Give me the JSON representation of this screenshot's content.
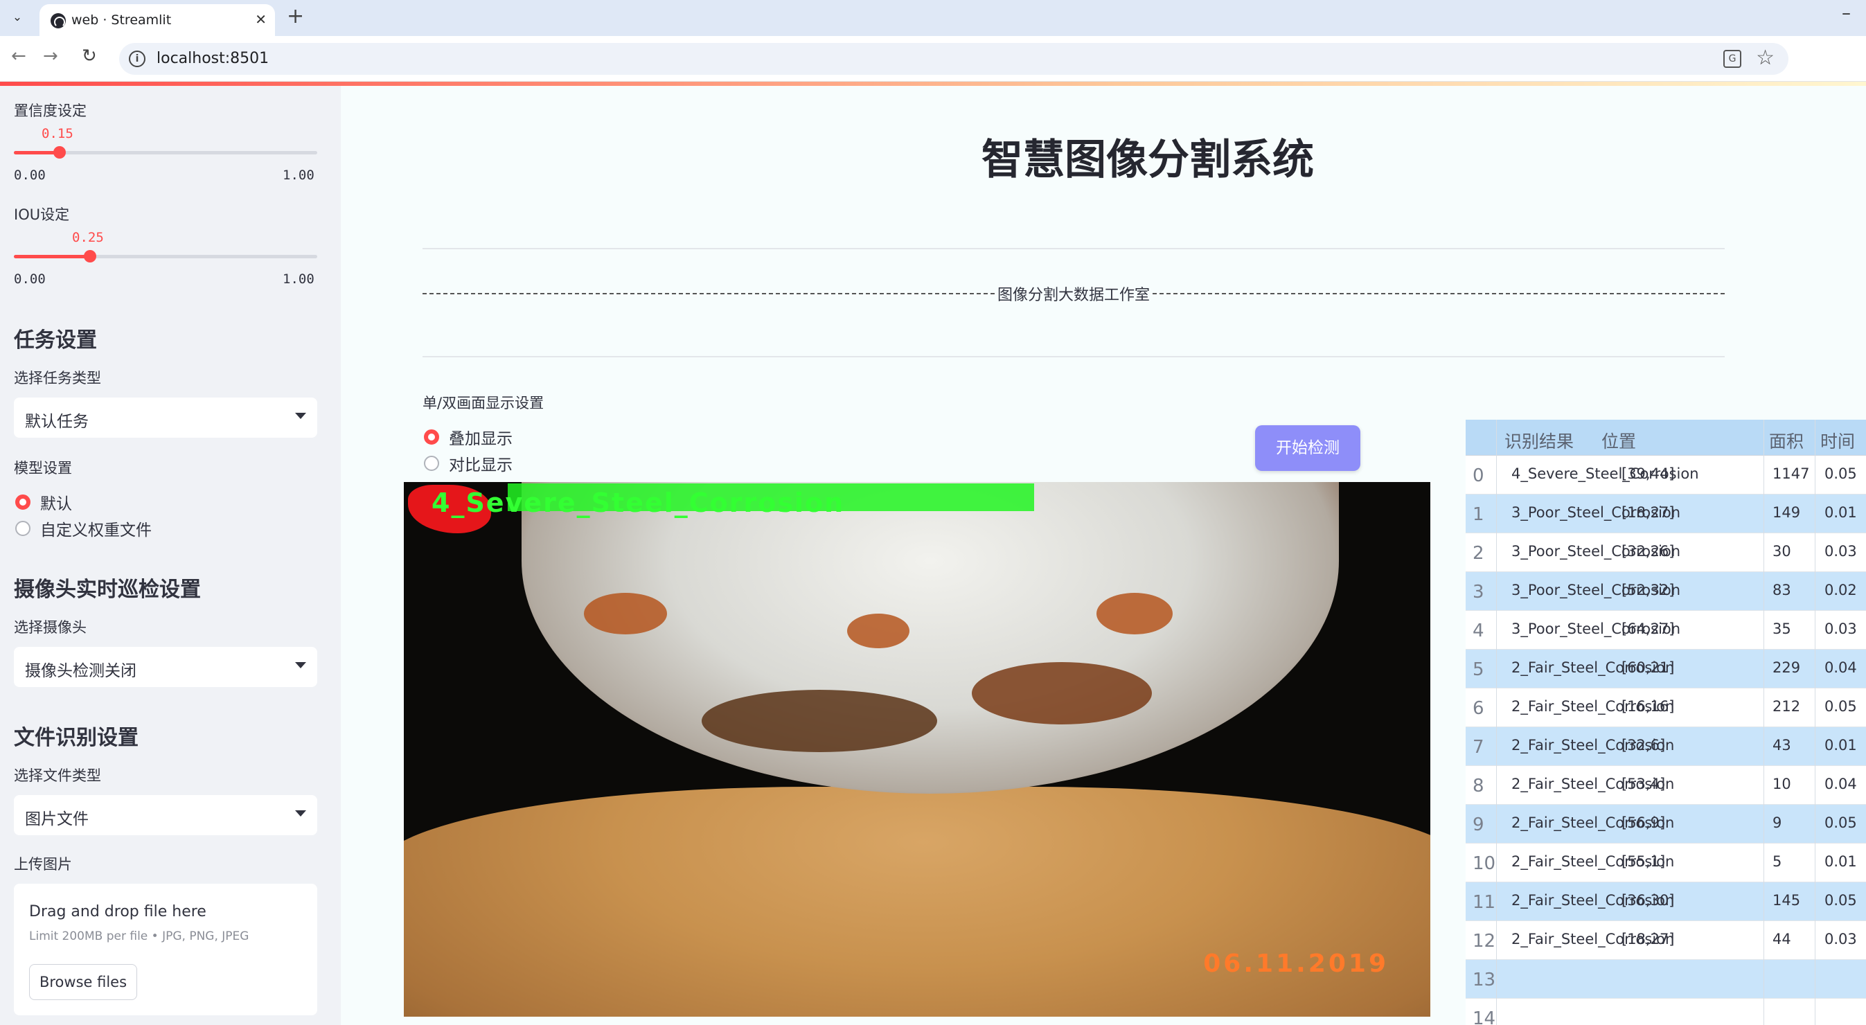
{
  "browser": {
    "tab_title": "web · Streamlit",
    "url": "localhost:8501"
  },
  "sidebar": {
    "confidence": {
      "label": "置信度设定",
      "value": "0.15",
      "fraction": 0.15,
      "min": "0.00",
      "max": "1.00"
    },
    "iou": {
      "label": "IOU设定",
      "value": "0.25",
      "fraction": 0.25,
      "min": "0.00",
      "max": "1.00"
    },
    "task_header": "任务设置",
    "task_type_label": "选择任务类型",
    "task_type_value": "默认任务",
    "model_label": "模型设置",
    "model_options": [
      "默认",
      "自定义权重文件"
    ],
    "model_selected": "默认",
    "camera_header": "摄像头实时巡检设置",
    "camera_label": "选择摄像头",
    "camera_value": "摄像头检测关闭",
    "file_header": "文件识别设置",
    "file_type_label": "选择文件类型",
    "file_type_value": "图片文件",
    "upload_label": "上传图片",
    "upload_title": "Drag and drop file here",
    "upload_hint": "Limit 200MB per file • JPG, PNG, JPEG",
    "browse_label": "Browse files"
  },
  "main": {
    "title": "智慧图像分割系统",
    "studio_text": "图像分割大数据工作室",
    "display_mode_label": "单/双画面显示设置",
    "display_options": [
      "叠加显示",
      "对比显示"
    ],
    "display_selected": "叠加显示",
    "start_button": "开始检测",
    "image": {
      "overlay_label": "4_Severe_Steel_Corrosion",
      "date_stamp": "06.11.2019"
    }
  },
  "table": {
    "columns": [
      "识别结果",
      "位置",
      "面积",
      "时间"
    ],
    "rows": [
      {
        "idx": "0",
        "result": "4_Severe_Steel_Corrosion",
        "pos": "[39,44]",
        "area": "1147",
        "time": "0.05"
      },
      {
        "idx": "1",
        "result": "3_Poor_Steel_Corrosion",
        "pos": "[18,27]",
        "area": "149",
        "time": "0.01"
      },
      {
        "idx": "2",
        "result": "3_Poor_Steel_Corrosion",
        "pos": "[32,26]",
        "area": "30",
        "time": "0.03"
      },
      {
        "idx": "3",
        "result": "3_Poor_Steel_Corrosion",
        "pos": "[52,32]",
        "area": "83",
        "time": "0.02"
      },
      {
        "idx": "4",
        "result": "3_Poor_Steel_Corrosion",
        "pos": "[64,27]",
        "area": "35",
        "time": "0.03"
      },
      {
        "idx": "5",
        "result": "2_Fair_Steel_Corrosion",
        "pos": "[60,21]",
        "area": "229",
        "time": "0.04"
      },
      {
        "idx": "6",
        "result": "2_Fair_Steel_Corrosion",
        "pos": "[16,16]",
        "area": "212",
        "time": "0.05"
      },
      {
        "idx": "7",
        "result": "2_Fair_Steel_Corrosion",
        "pos": "[32,6]",
        "area": "43",
        "time": "0.01"
      },
      {
        "idx": "8",
        "result": "2_Fair_Steel_Corrosion",
        "pos": "[53,4]",
        "area": "10",
        "time": "0.04"
      },
      {
        "idx": "9",
        "result": "2_Fair_Steel_Corrosion",
        "pos": "[56,9]",
        "area": "9",
        "time": "0.05"
      },
      {
        "idx": "10",
        "result": "2_Fair_Steel_Corrosion",
        "pos": "[55,1]",
        "area": "5",
        "time": "0.01"
      },
      {
        "idx": "11",
        "result": "2_Fair_Steel_Corrosion",
        "pos": "[36,30]",
        "area": "145",
        "time": "0.05"
      },
      {
        "idx": "12",
        "result": "2_Fair_Steel_Corrosion",
        "pos": "[18,27]",
        "area": "44",
        "time": "0.03"
      },
      {
        "idx": "13",
        "result": "",
        "pos": "",
        "area": "",
        "time": ""
      },
      {
        "idx": "14",
        "result": "",
        "pos": "",
        "area": "",
        "time": ""
      }
    ]
  },
  "colors": {
    "accent": "#ff4b4b",
    "button": "#8e8ef9",
    "table_header": "#b9daf6",
    "table_alt_row": "#c9e4fa"
  }
}
